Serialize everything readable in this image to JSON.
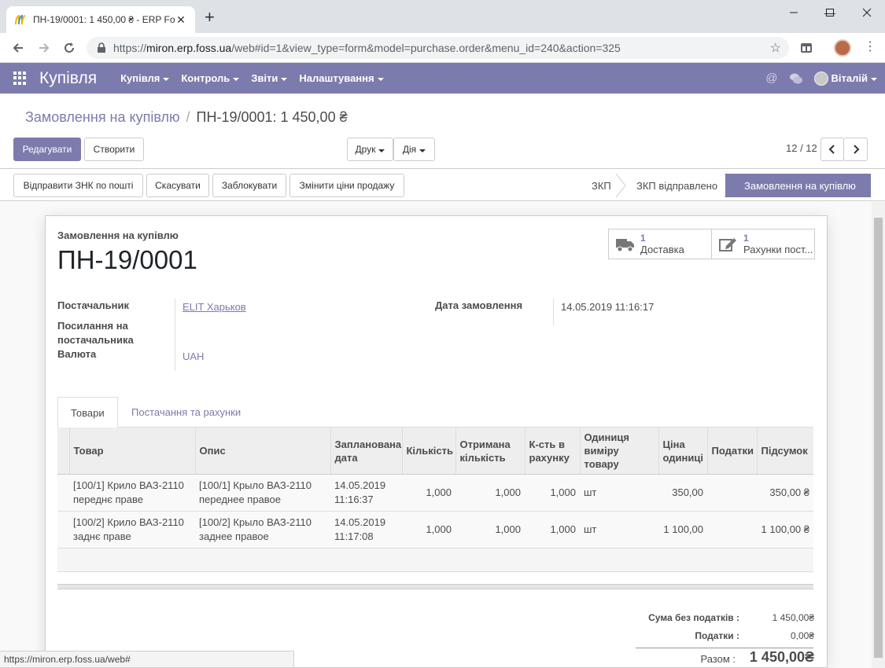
{
  "browser": {
    "tab_title": "ПН-19/0001: 1 450,00 ₴ - ERP Fo",
    "url_scheme": "https://",
    "url_host": "miron.erp.foss.ua",
    "url_path": "/web#id=1&view_type=form&model=purchase.order&menu_id=240&action=325",
    "status_url": "https://miron.erp.foss.ua/web#"
  },
  "navbar": {
    "app_name": "Купівля",
    "menu": [
      "Купівля",
      "Контроль",
      "Звіти",
      "Налаштування"
    ],
    "user": "Віталій",
    "color": "#7c7bad"
  },
  "breadcrumb": {
    "parent": "Замовлення на купівлю",
    "current": "ПН-19/0001: 1 450,00 ₴"
  },
  "toolbar": {
    "edit": "Редагувати",
    "create": "Створити",
    "print": "Друк",
    "action": "Дія",
    "pager": "12 / 12"
  },
  "header_buttons": [
    "Відправити ЗНК по пошті",
    "Скасувати",
    "Заблокувати",
    "Змінити ціни продажу"
  ],
  "stages": [
    "ЗКП",
    "ЗКП відправлено",
    "Замовлення на купівлю"
  ],
  "form": {
    "small_title": "Замовлення на купівлю",
    "name": "ПН-19/0001",
    "smart_buttons": [
      {
        "value": "1",
        "label": "Доставка",
        "icon": "truck-icon"
      },
      {
        "value": "1",
        "label": "Рахунки пост...",
        "icon": "pencil-square-icon"
      }
    ],
    "fields": {
      "partner_label": "Постачальник",
      "partner_value": "ELIT Харьков",
      "ref_label_1": "Посилання на",
      "ref_label_2": "постачальника",
      "currency_label": "Валюта",
      "currency_value": "UAH",
      "date_label": "Дата замовлення",
      "date_value": "14.05.2019 11:16:17"
    },
    "tabs": [
      "Товари",
      "Постачання та рахунки"
    ]
  },
  "lines": {
    "headers": [
      "Товар",
      "Опис",
      "Запланована дата",
      "Кількість",
      "Отримана кількість",
      "К-сть в рахунку",
      "Одиниця виміру товару",
      "Ціна одиниці",
      "Податки",
      "Підсумок"
    ],
    "rows": [
      {
        "product": "[100/1] Крило ВАЗ-2110 переднє праве",
        "description": "[100/1] Крыло ВАЗ-2110 переднее правое",
        "date": "14.05.2019 11:16:37",
        "qty": "1,000",
        "received": "1,000",
        "invoiced": "1,000",
        "uom": "шт",
        "price": "350,00",
        "taxes": "",
        "subtotal": "350,00 ₴"
      },
      {
        "product": "[100/2] Крило ВАЗ-2110 заднє праве",
        "description": "[100/2] Крыло ВАЗ-2110 заднее правое",
        "date": "14.05.2019 11:17:08",
        "qty": "1,000",
        "received": "1,000",
        "invoiced": "1,000",
        "uom": "шт",
        "price": "1 100,00",
        "taxes": "",
        "subtotal": "1 100,00 ₴"
      }
    ]
  },
  "totals": {
    "untaxed_label": "Сума без податків :",
    "untaxed_value": "1 450,00₴",
    "taxes_label": "Податки :",
    "taxes_value": "0,00₴",
    "total_label": "Разом :",
    "total_value": "1 450,00₴"
  }
}
